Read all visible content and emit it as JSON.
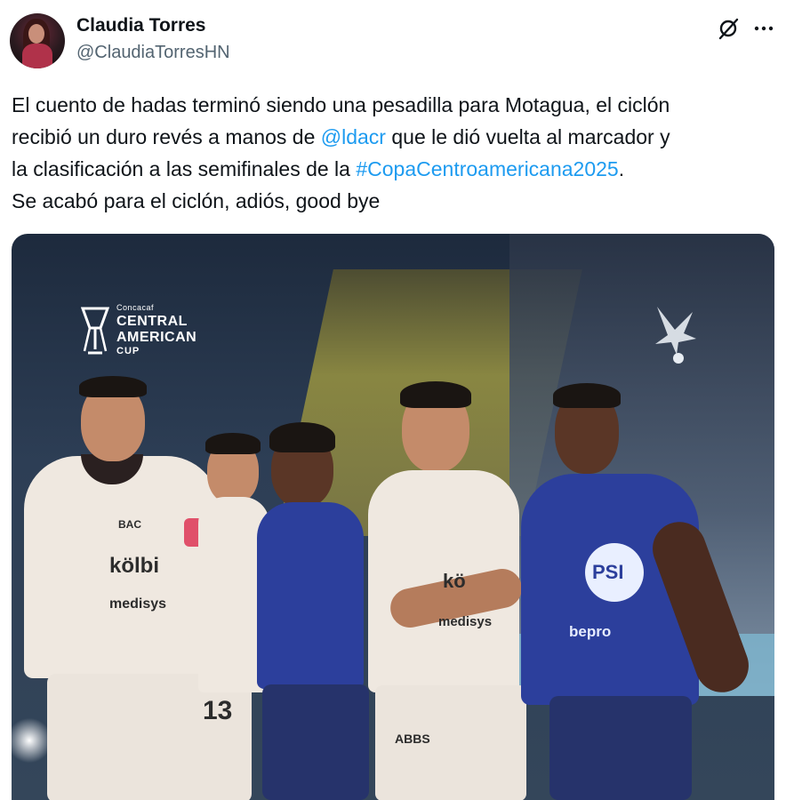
{
  "author": {
    "name": "Claudia Torres",
    "handle": "@ClaudiaTorresHN"
  },
  "actions": {
    "grok_icon": "grok-icon",
    "more_icon": "more-icon"
  },
  "tweet": {
    "line1": "El cuento de hadas terminó siendo una pesadilla para Motagua, el ciclón",
    "line2_before": "recibió un duro revés a manos de ",
    "mention": "@ldacr",
    "line2_after": " que le dió vuelta al marcador y",
    "line3_before": "la clasificación a las semifinales de la ",
    "hashtag": "#CopaCentroamericana2025",
    "line3_after": ".",
    "line4": "Se acabó para el ciclón, adiós, good bye"
  },
  "media": {
    "logo_small": "Concacaf",
    "logo_line1": "CENTRAL",
    "logo_line2": "AMERICAN",
    "logo_line3": "CUP",
    "sponsor_kolbi": "kölbi",
    "sponsor_medisys": "medisys",
    "sponsor_bac": "BAC",
    "sponsor_kolbi2": "kö",
    "sponsor_medisys2": "medisys",
    "sponsor_pepsi": "PSI",
    "sponsor_bepro": "bepro",
    "sponsor_abbs": "ABBS",
    "number_13": "13",
    "colors": {
      "white_kit": "#efe8e0",
      "blue_kit": "#2c3f9c",
      "link": "#1d9bf0"
    }
  }
}
